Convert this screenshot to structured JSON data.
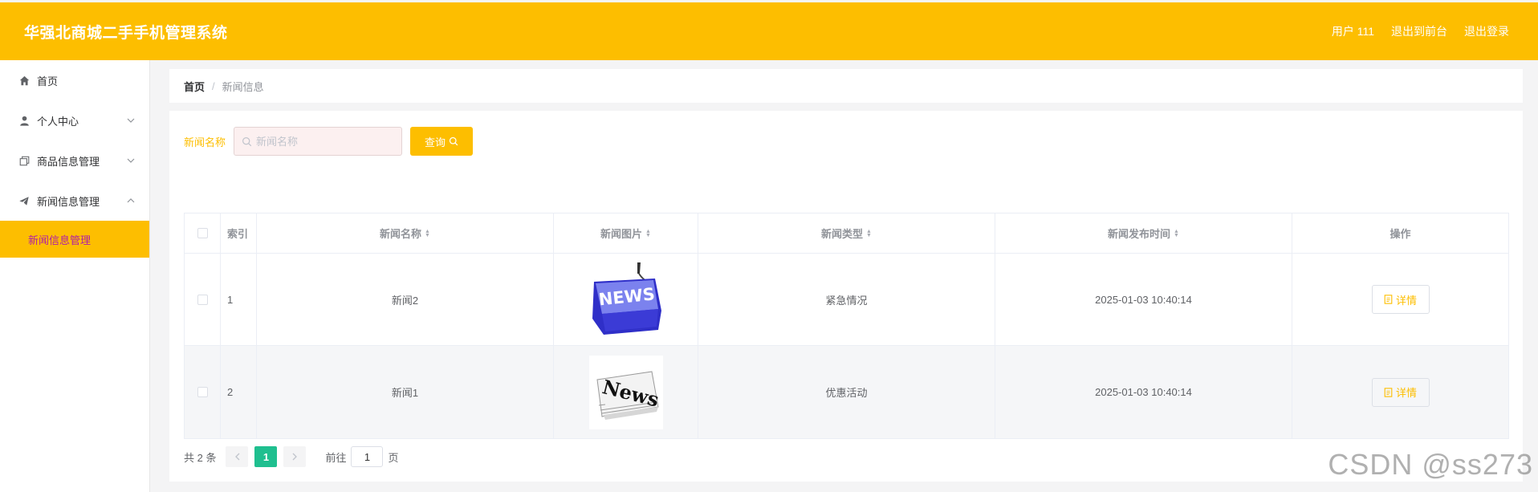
{
  "header": {
    "title": "华强北商城二手手机管理系统",
    "user": "用户 111",
    "to_front": "退出到前台",
    "logout": "退出登录"
  },
  "sidebar": {
    "items": [
      {
        "label": "首页",
        "icon": "home-icon"
      },
      {
        "label": "个人中心",
        "icon": "user-icon",
        "chevron": "down"
      },
      {
        "label": "商品信息管理",
        "icon": "copy-icon",
        "chevron": "down"
      },
      {
        "label": "新闻信息管理",
        "icon": "send-icon",
        "chevron": "up"
      }
    ],
    "active_sub": "新闻信息管理"
  },
  "breadcrumb": {
    "home": "首页",
    "separator": "/",
    "current": "新闻信息"
  },
  "search": {
    "label": "新闻名称",
    "placeholder": "新闻名称",
    "value": "",
    "button": "查询"
  },
  "table": {
    "headers": {
      "index": "索引",
      "name": "新闻名称",
      "image": "新闻图片",
      "type": "新闻类型",
      "time": "新闻发布时间",
      "actions": "操作"
    },
    "rows": [
      {
        "index": "1",
        "name": "新闻2",
        "image": "news-keyboard-key",
        "type": "紧急情况",
        "time": "2025-01-03 10:40:14",
        "action": "详情"
      },
      {
        "index": "2",
        "name": "新闻1",
        "image": "news-newspaper",
        "type": "优惠活动",
        "time": "2025-01-03 10:40:14",
        "action": "详情"
      }
    ]
  },
  "pagination": {
    "total": "共 2 条",
    "current_page": "1",
    "goto_prefix": "前往",
    "goto_value": "1",
    "goto_suffix": "页"
  },
  "watermark": "CSDN @ss273",
  "colors": {
    "accent": "#fdbe00",
    "active_text": "#b01fa8",
    "page_active": "#1fbf8f"
  }
}
